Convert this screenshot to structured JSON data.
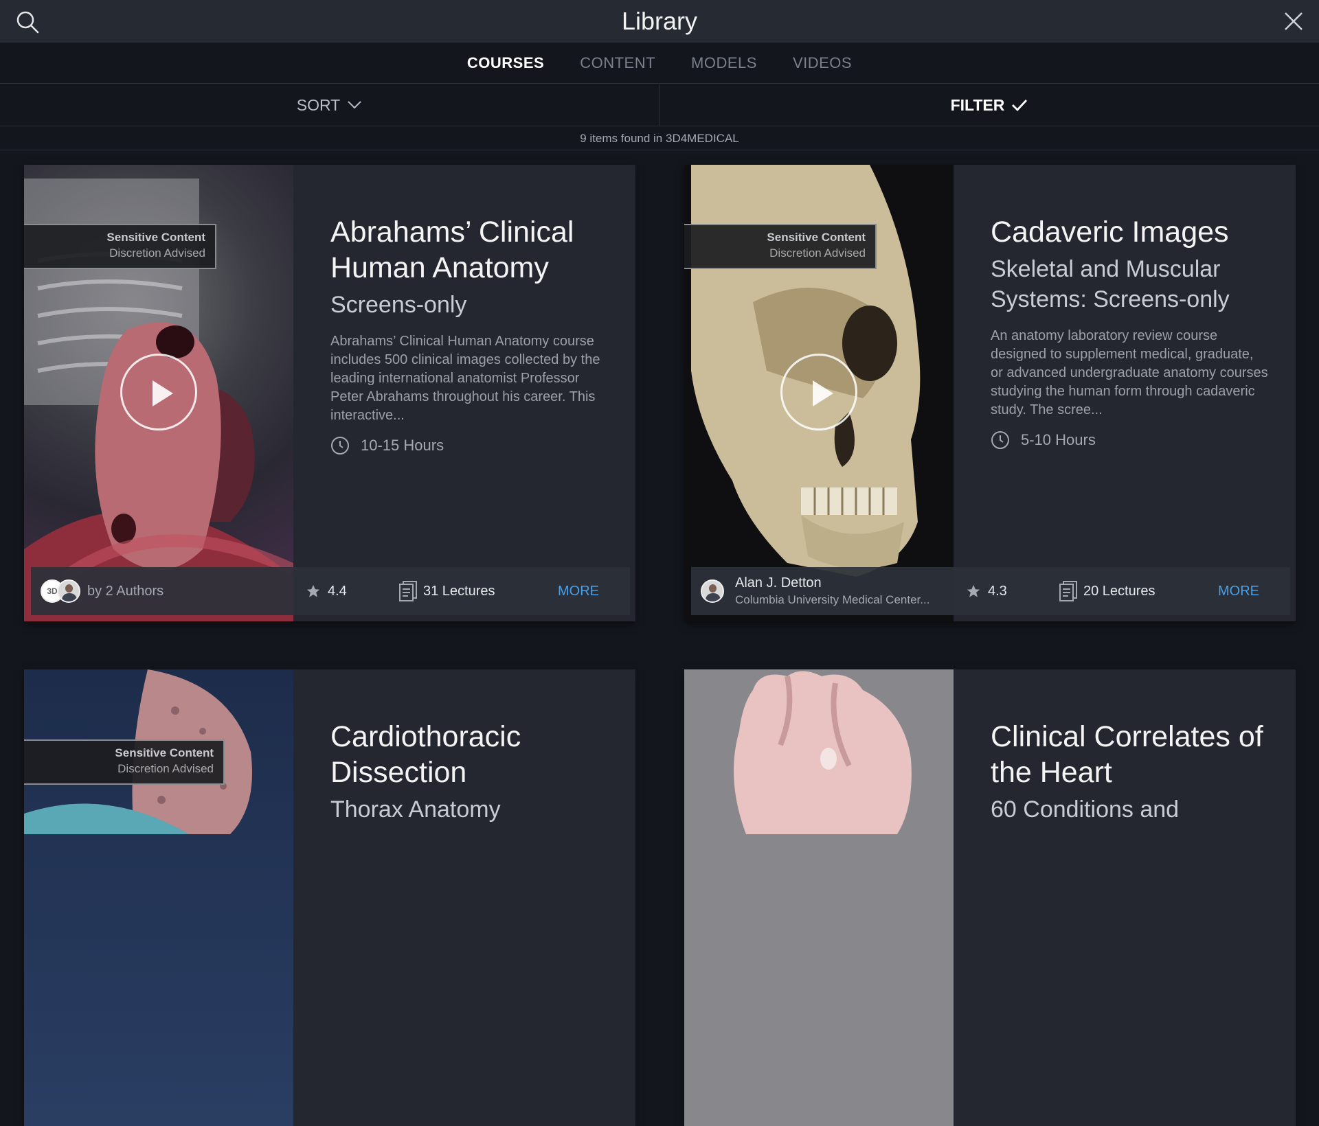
{
  "header": {
    "title": "Library"
  },
  "tabs": [
    {
      "label": "COURSES",
      "active": true
    },
    {
      "label": "CONTENT",
      "active": false
    },
    {
      "label": "MODELS",
      "active": false
    },
    {
      "label": "VIDEOS",
      "active": false
    }
  ],
  "toolbar": {
    "sort_label": "SORT",
    "filter_label": "FILTER"
  },
  "status": {
    "text": "9 items found in 3D4MEDICAL"
  },
  "sensitive": {
    "title": "Sensitive Content",
    "subtitle": "Discretion Advised"
  },
  "cards": [
    {
      "title": "Abrahams’ Clinical Human Anatomy",
      "subtitle": "Screens-only",
      "description": "Abrahams’ Clinical Human Anatomy course includes 500 clinical images collected by the leading international anatomist Professor Peter Abrahams throughout his career. This interactive...",
      "duration": "10-15 Hours",
      "authors": "by 2 Authors",
      "rating": "4.4",
      "lectures": "31 Lectures",
      "more": "MORE"
    },
    {
      "title": "Cadaveric Images",
      "subtitle": "Skeletal and Muscular Systems: Screens-only",
      "description": "An anatomy laboratory review course designed to supplement medical, graduate, or advanced undergraduate anatomy courses studying the human form through cadaveric study. The scree...",
      "duration": "5-10 Hours",
      "author_name": "Alan J. Detton",
      "author_org": "Columbia University Medical Center...",
      "rating": "4.3",
      "lectures": "20 Lectures",
      "more": "MORE"
    },
    {
      "title": "Cardiothoracic Dissection",
      "subtitle": "Thorax Anatomy"
    },
    {
      "title": "Clinical Correlates of the Heart",
      "subtitle": "60 Conditions and"
    }
  ]
}
